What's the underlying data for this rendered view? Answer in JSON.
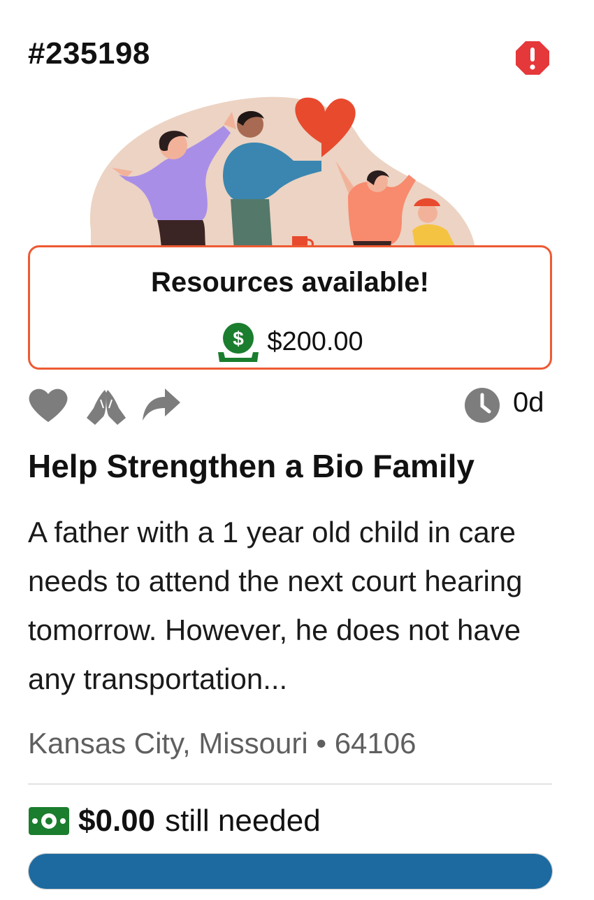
{
  "request": {
    "id": "#235198",
    "title": "Help Strengthen a Bio Family",
    "description": "A father with a 1 year old child in care needs to attend the next court hearing tomorrow. However, he does not have any transportation...",
    "location": "Kansas City, Missouri • 64106",
    "age": "0d"
  },
  "resources": {
    "heading": "Resources available!",
    "amount": "$200.00"
  },
  "funding": {
    "amount_needed": "$0.00",
    "label": "still needed",
    "progress_fraction": 1.0
  },
  "icons": {
    "alert": "alert-octagon-icon",
    "money_bag": "money-bag-icon",
    "heart": "heart-icon",
    "praying_hands": "praying-hands-icon",
    "share": "share-icon",
    "clock": "clock-icon",
    "cash": "cash-icon"
  },
  "colors": {
    "accent_border": "#ee5a33",
    "alert_red": "#e5383b",
    "money_green": "#1b7d2e",
    "progress_blue": "#1c6aa0",
    "icon_gray": "#7d7d7d"
  }
}
